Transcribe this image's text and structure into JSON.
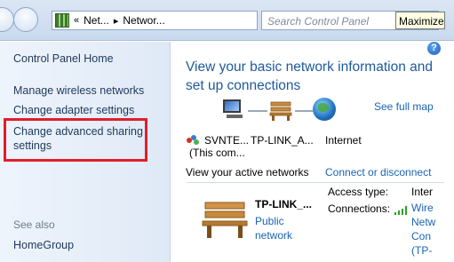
{
  "address_bar": {
    "separator": "«",
    "crumbs": [
      "Net...",
      "Networ..."
    ],
    "arrow": "▸"
  },
  "search": {
    "placeholder": "Search Control Panel"
  },
  "tooltip": "Maximize",
  "left_pane": {
    "home": "Control Panel Home",
    "links": [
      "Manage wireless networks",
      "Change adapter settings",
      "Change advanced sharing settings"
    ],
    "see_also": "See also",
    "see_also_links": [
      "HomeGroup"
    ]
  },
  "main": {
    "title": "View your basic network information and set up connections",
    "see_full_map": "See full map",
    "map": {
      "computer_label": "SVNTE...",
      "computer_sub": "(This com...",
      "network_label": "TP-LINK_A...",
      "internet_label": "Internet"
    },
    "active_networks_label": "View your active networks",
    "connect_link": "Connect or disconnect",
    "network": {
      "name": "TP-LINK_...",
      "type_link": "Public network",
      "access_type_label": "Access type:",
      "access_type_value": "Inter",
      "connections_label": "Connections:",
      "connections_value": "Wire Netw Con (TP-",
      "connections_lines": [
        "Wire",
        "Netw",
        "Con",
        "(TP-"
      ]
    }
  },
  "help_icon": "?",
  "colors": {
    "highlight": "#e21d2b",
    "link": "#1a64b4",
    "title": "#1e5a9c"
  }
}
